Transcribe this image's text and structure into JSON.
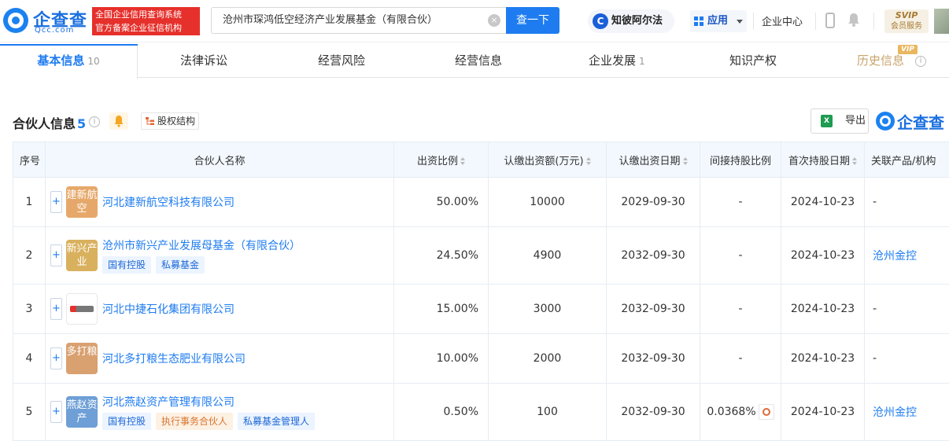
{
  "header": {
    "logo_cn": "企查查",
    "logo_en": "Qcc.com",
    "slogan_line1": "全国企业信用查询系统",
    "slogan_line2": "官方备案企业征信机构",
    "search_value": "沧州市琛鸿低空经济产业发展基金（有限合伙）",
    "search_button": "查一下",
    "zbae_label": "知彼阿尔法",
    "apps_label": "应用",
    "biz_center": "企业中心",
    "svip_line1": "SVIP",
    "svip_line2": "会员服务"
  },
  "tabs": [
    {
      "label": "基本信息",
      "count": "10",
      "active": true
    },
    {
      "label": "法律诉讼",
      "count": ""
    },
    {
      "label": "经营风险",
      "count": ""
    },
    {
      "label": "经营信息",
      "count": ""
    },
    {
      "label": "企业发展",
      "count": "1"
    },
    {
      "label": "知识产权",
      "count": ""
    },
    {
      "label": "历史信息",
      "count": "",
      "badge": "VIP"
    }
  ],
  "section": {
    "title": "合伙人信息",
    "count": "5",
    "equity_button": "股权结构",
    "export_button": "导出",
    "brand": "企查查"
  },
  "table": {
    "headers": {
      "index": "序号",
      "name": "合伙人名称",
      "ratio": "出资比例",
      "amount": "认缴出资额(万元)",
      "date": "认缴出资日期",
      "indirect": "间接持股比例",
      "first_date": "首次持股日期",
      "related": "关联产品/机构"
    },
    "rows": [
      {
        "index": "1",
        "logo": "建新航空",
        "logo_color": "#e6a86a",
        "name": "河北建新航空科技有限公司",
        "tags": [],
        "ratio": "50.00%",
        "amount": "10000",
        "date": "2029-09-30",
        "indirect": "-",
        "first_date": "2024-10-23",
        "related": "-"
      },
      {
        "index": "2",
        "logo": "新兴产业",
        "logo_color": "#d9b15e",
        "name": "沧州市新兴产业发展母基金（有限合伙）",
        "tags": [
          {
            "text": "国有控股",
            "style": "blue"
          },
          {
            "text": "私募基金",
            "style": "blue"
          }
        ],
        "ratio": "24.50%",
        "amount": "4900",
        "date": "2032-09-30",
        "indirect": "-",
        "first_date": "2024-10-23",
        "related": "沧州金控"
      },
      {
        "index": "3",
        "logo": "",
        "logo_color": "#ffffff",
        "name": "河北中捷石化集团有限公司",
        "tags": [],
        "ratio": "15.00%",
        "amount": "3000",
        "date": "2032-09-30",
        "indirect": "-",
        "first_date": "2024-10-23",
        "related": "-"
      },
      {
        "index": "4",
        "logo": "多打粮",
        "logo_color": "#d9a070",
        "name": "河北多打粮生态肥业有限公司",
        "tags": [],
        "ratio": "10.00%",
        "amount": "2000",
        "date": "2032-09-30",
        "indirect": "-",
        "first_date": "2024-10-23",
        "related": "-"
      },
      {
        "index": "5",
        "logo": "燕赵资产",
        "logo_color": "#6e9fd6",
        "name": "河北燕赵资产管理有限公司",
        "tags": [
          {
            "text": "国有控股",
            "style": "blue"
          },
          {
            "text": "执行事务合伙人",
            "style": "orange"
          },
          {
            "text": "私募基金管理人",
            "style": "blue"
          }
        ],
        "ratio": "0.50%",
        "amount": "100",
        "date": "2032-09-30",
        "indirect": "0.0368%",
        "first_date": "2024-10-23",
        "related": "沧州金控"
      }
    ]
  },
  "colors": {
    "brand_blue": "#1e7cf0",
    "slogan_red": "#e6302b",
    "header_bg": "#f2f8fe"
  }
}
